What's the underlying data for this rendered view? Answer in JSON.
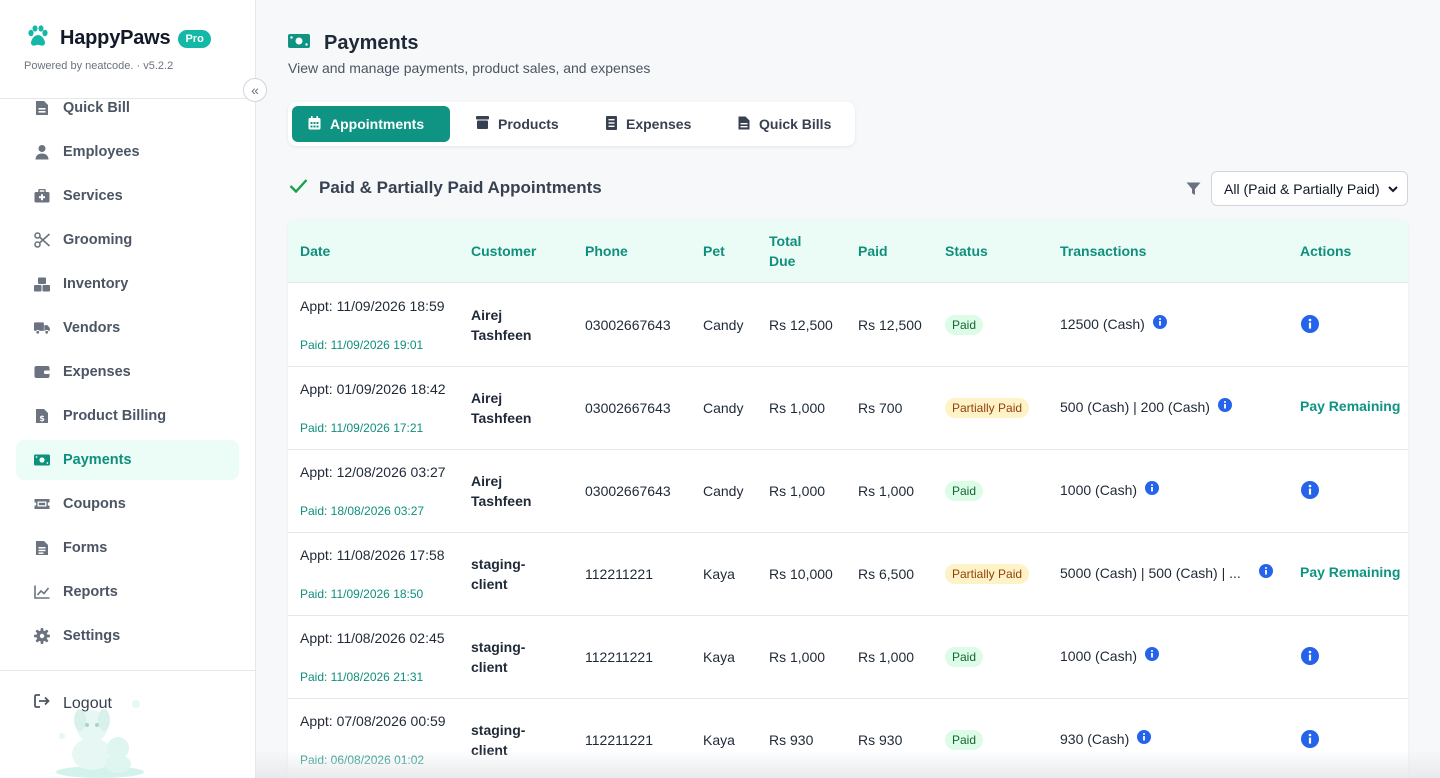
{
  "brand": {
    "name": "HappyPaws",
    "badge": "Pro",
    "powered_by": "Powered by neatcode. · v5.2.2",
    "collapse_glyph": "«"
  },
  "sidebar": {
    "items": [
      {
        "label": "Quick Bill",
        "icon": "file-invoice-icon"
      },
      {
        "label": "Employees",
        "icon": "user-icon"
      },
      {
        "label": "Services",
        "icon": "briefcase-medical-icon"
      },
      {
        "label": "Grooming",
        "icon": "scissors-icon"
      },
      {
        "label": "Inventory",
        "icon": "boxes-icon"
      },
      {
        "label": "Vendors",
        "icon": "truck-icon"
      },
      {
        "label": "Expenses",
        "icon": "wallet-icon"
      },
      {
        "label": "Product Billing",
        "icon": "file-invoice-dollar-icon"
      },
      {
        "label": "Payments",
        "icon": "money-bill-icon",
        "active": true
      },
      {
        "label": "Coupons",
        "icon": "ticket-icon"
      },
      {
        "label": "Forms",
        "icon": "file-alt-icon"
      },
      {
        "label": "Reports",
        "icon": "chart-line-icon"
      },
      {
        "label": "Settings",
        "icon": "cog-icon"
      }
    ],
    "logout": "Logout"
  },
  "page": {
    "title": "Payments",
    "subtitle": "View and manage payments, product sales, and expenses"
  },
  "tabs": [
    {
      "label": "Appointments",
      "icon": "calendar-icon",
      "active": true
    },
    {
      "label": "Products",
      "icon": "box-icon"
    },
    {
      "label": "Expenses",
      "icon": "receipt-icon"
    },
    {
      "label": "Quick Bills",
      "icon": "file-invoice-icon"
    }
  ],
  "section": {
    "title": "Paid & Partially Paid Appointments",
    "filter_value": "All (Paid & Partially Paid)"
  },
  "table": {
    "headers": [
      "Date",
      "Customer",
      "Phone",
      "Pet",
      "Total Due",
      "Paid",
      "Status",
      "Transactions",
      "Actions"
    ],
    "rows": [
      {
        "appt": "Appt: 11/09/2026 18:59",
        "paid_on": "Paid: 11/09/2026 19:01",
        "customer": "Airej Tashfeen",
        "phone": "03002667643",
        "pet": "Candy",
        "total_due": "Rs 12,500",
        "paid": "Rs 12,500",
        "status": "Paid",
        "transactions": "12500 (Cash)",
        "action": ""
      },
      {
        "appt": "Appt: 01/09/2026 18:42",
        "paid_on": "Paid: 11/09/2026 17:21",
        "customer": "Airej Tashfeen",
        "phone": "03002667643",
        "pet": "Candy",
        "total_due": "Rs 1,000",
        "paid": "Rs 700",
        "status": "Partially Paid",
        "transactions": "500 (Cash) | 200 (Cash)",
        "action": "Pay Remaining"
      },
      {
        "appt": "Appt: 12/08/2026 03:27",
        "paid_on": "Paid: 18/08/2026 03:27",
        "customer": "Airej Tashfeen",
        "phone": "03002667643",
        "pet": "Candy",
        "total_due": "Rs 1,000",
        "paid": "Rs 1,000",
        "status": "Paid",
        "transactions": "1000 (Cash)",
        "action": ""
      },
      {
        "appt": "Appt: 11/08/2026 17:58",
        "paid_on": "Paid: 11/09/2026 18:50",
        "customer": "staging-client",
        "phone": "112211221",
        "pet": "Kaya",
        "total_due": "Rs 10,000",
        "paid": "Rs 6,500",
        "status": "Partially Paid",
        "transactions": "5000 (Cash) | 500 (Cash) | ...",
        "action": "Pay Remaining"
      },
      {
        "appt": "Appt: 11/08/2026 02:45",
        "paid_on": "Paid: 11/08/2026 21:31",
        "customer": "staging-client",
        "phone": "112211221",
        "pet": "Kaya",
        "total_due": "Rs 1,000",
        "paid": "Rs 1,000",
        "status": "Paid",
        "transactions": "1000 (Cash)",
        "action": ""
      },
      {
        "appt": "Appt: 07/08/2026 00:59",
        "paid_on": "Paid: 06/08/2026 01:02",
        "customer": "staging-client",
        "phone": "112211221",
        "pet": "Kaya",
        "total_due": "Rs 930",
        "paid": "Rs 930",
        "status": "Paid",
        "transactions": "930 (Cash)",
        "action": ""
      }
    ]
  },
  "colors": {
    "accent": "#0f9483",
    "accent_text": "#0f8f7c",
    "header_bg": "#ebfcf7",
    "info": "#2563eb",
    "paid_bg": "#dcfce7",
    "partial_bg": "#fef3c7"
  }
}
